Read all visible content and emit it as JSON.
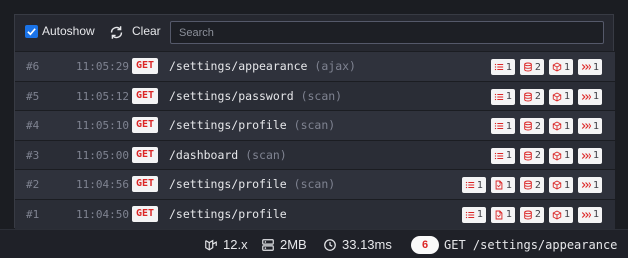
{
  "toolbar": {
    "autoshow_label": "Autoshow",
    "autoshow_checked": true,
    "clear_label": "Clear",
    "search_placeholder": "Search",
    "search_value": ""
  },
  "colors": {
    "method_text": "#dc2626",
    "badge_icon": "#dc2626",
    "checkbox": "#1a73e8"
  },
  "requests": [
    {
      "id": "#6",
      "time": "11:05:29",
      "method": "GET",
      "path": "/settings/appearance",
      "tag": "(ajax)",
      "badges": [
        {
          "icon": "list-icon",
          "count": "1"
        },
        {
          "icon": "database-icon",
          "count": "2"
        },
        {
          "icon": "cube-icon",
          "count": "1"
        },
        {
          "icon": "double-chevron-icon",
          "count": "1"
        }
      ]
    },
    {
      "id": "#5",
      "time": "11:05:12",
      "method": "GET",
      "path": "/settings/password",
      "tag": "(scan)",
      "badges": [
        {
          "icon": "list-icon",
          "count": "1"
        },
        {
          "icon": "database-icon",
          "count": "2"
        },
        {
          "icon": "cube-icon",
          "count": "1"
        },
        {
          "icon": "double-chevron-icon",
          "count": "1"
        }
      ]
    },
    {
      "id": "#4",
      "time": "11:05:10",
      "method": "GET",
      "path": "/settings/profile",
      "tag": "(scan)",
      "badges": [
        {
          "icon": "list-icon",
          "count": "1"
        },
        {
          "icon": "database-icon",
          "count": "2"
        },
        {
          "icon": "cube-icon",
          "count": "1"
        },
        {
          "icon": "double-chevron-icon",
          "count": "1"
        }
      ]
    },
    {
      "id": "#3",
      "time": "11:05:00",
      "method": "GET",
      "path": "/dashboard",
      "tag": "(scan)",
      "badges": [
        {
          "icon": "list-icon",
          "count": "1"
        },
        {
          "icon": "database-icon",
          "count": "2"
        },
        {
          "icon": "cube-icon",
          "count": "1"
        },
        {
          "icon": "double-chevron-icon",
          "count": "1"
        }
      ]
    },
    {
      "id": "#2",
      "time": "11:04:56",
      "method": "GET",
      "path": "/settings/profile",
      "tag": "(scan)",
      "badges": [
        {
          "icon": "list-icon",
          "count": "1"
        },
        {
          "icon": "file-icon",
          "count": "1"
        },
        {
          "icon": "database-icon",
          "count": "2"
        },
        {
          "icon": "cube-icon",
          "count": "1"
        },
        {
          "icon": "double-chevron-icon",
          "count": "1"
        }
      ]
    },
    {
      "id": "#1",
      "time": "11:04:50",
      "method": "GET",
      "path": "/settings/profile",
      "tag": "",
      "badges": [
        {
          "icon": "list-icon",
          "count": "1"
        },
        {
          "icon": "file-icon",
          "count": "1"
        },
        {
          "icon": "database-icon",
          "count": "2"
        },
        {
          "icon": "cube-icon",
          "count": "1"
        },
        {
          "icon": "double-chevron-icon",
          "count": "1"
        }
      ]
    }
  ],
  "statusbar": {
    "framework_icon": "laravel-icon",
    "framework_version": "12.x",
    "memory_icon": "server-icon",
    "memory": "2MB",
    "duration_icon": "clock-icon",
    "duration": "33.13ms",
    "request_count": "6",
    "current_request": "GET /settings/appearance"
  }
}
